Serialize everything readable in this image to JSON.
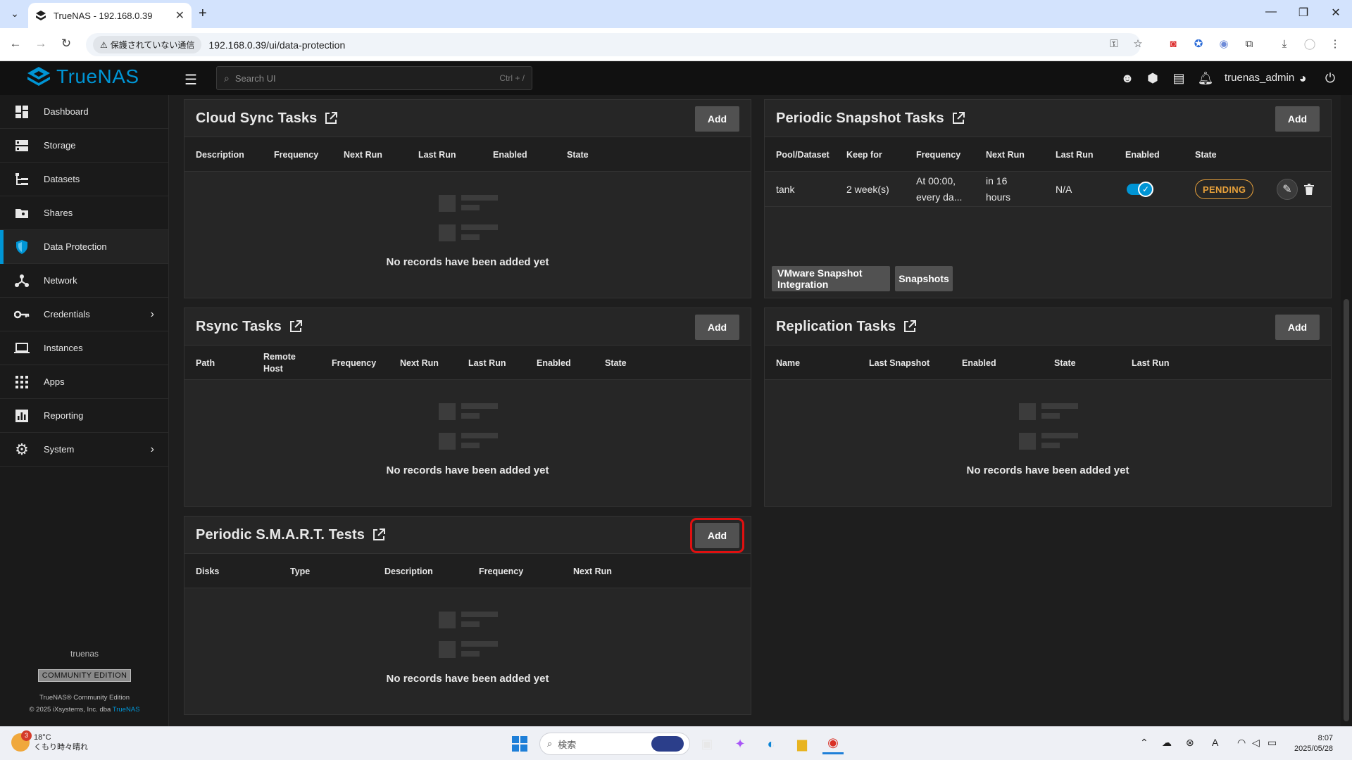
{
  "browser": {
    "tab_title": "TrueNAS - 192.168.0.39",
    "security_label": "保護されていない通信",
    "url": "192.168.0.39/ui/data-protection"
  },
  "header": {
    "brand": "TrueNAS",
    "search_placeholder": "Search UI",
    "search_shortcut": "Ctrl + /",
    "username": "truenas_admin"
  },
  "sidebar": {
    "items": [
      {
        "label": "Dashboard",
        "icon": "dashboard-icon"
      },
      {
        "label": "Storage",
        "icon": "storage-icon"
      },
      {
        "label": "Datasets",
        "icon": "datasets-icon"
      },
      {
        "label": "Shares",
        "icon": "shares-icon"
      },
      {
        "label": "Data Protection",
        "icon": "shield-icon"
      },
      {
        "label": "Network",
        "icon": "network-icon"
      },
      {
        "label": "Credentials",
        "icon": "key-icon"
      },
      {
        "label": "Instances",
        "icon": "laptop-icon"
      },
      {
        "label": "Apps",
        "icon": "apps-grid-icon"
      },
      {
        "label": "Reporting",
        "icon": "chart-icon"
      },
      {
        "label": "System",
        "icon": "gear-icon"
      }
    ],
    "active": "Data Protection",
    "hostname": "truenas",
    "edition": "COMMUNITY EDITION",
    "copyright_line1": "TrueNAS® Community Edition",
    "copyright_line2": "© 2025 iXsystems, Inc. dba",
    "copyright_link": "TrueNAS"
  },
  "cards": {
    "cloud_sync": {
      "title": "Cloud Sync Tasks",
      "add": "Add",
      "columns": [
        "Description",
        "Frequency",
        "Next Run",
        "Last Run",
        "Enabled",
        "State"
      ],
      "empty": "No records have been added yet"
    },
    "rsync": {
      "title": "Rsync Tasks",
      "add": "Add",
      "columns": [
        "Path",
        "Remote Host",
        "Frequency",
        "Next Run",
        "Last Run",
        "Enabled",
        "State"
      ],
      "empty": "No records have been added yet"
    },
    "smart": {
      "title": "Periodic S.M.A.R.T. Tests",
      "add": "Add",
      "columns": [
        "Disks",
        "Type",
        "Description",
        "Frequency",
        "Next Run"
      ],
      "empty": "No records have been added yet"
    },
    "snapshot": {
      "title": "Periodic Snapshot Tasks",
      "add": "Add",
      "columns": [
        "Pool/Dataset",
        "Keep for",
        "Frequency",
        "Next Run",
        "Last Run",
        "Enabled",
        "State"
      ],
      "row": {
        "pool": "tank",
        "keep_for": "2 week(s)",
        "frequency": "At 00:00, every da...",
        "next_run": "in 16 hours",
        "last_run": "N/A",
        "state": "PENDING",
        "enabled": true
      },
      "buttons": [
        "VMware Snapshot Integration",
        "Snapshots"
      ]
    },
    "replication": {
      "title": "Replication Tasks",
      "add": "Add",
      "columns": [
        "Name",
        "Last Snapshot",
        "Enabled",
        "State",
        "Last Run"
      ],
      "empty": "No records have been added yet"
    }
  },
  "taskbar": {
    "weather_temp": "18°C",
    "weather_desc": "くもり時々晴れ",
    "weather_badge": "3",
    "search_placeholder": "検索",
    "time": "8:07",
    "date": "2025/05/28"
  },
  "colors": {
    "accent": "#0095d5",
    "pending": "#e8a13b",
    "highlight": "#e01010"
  }
}
